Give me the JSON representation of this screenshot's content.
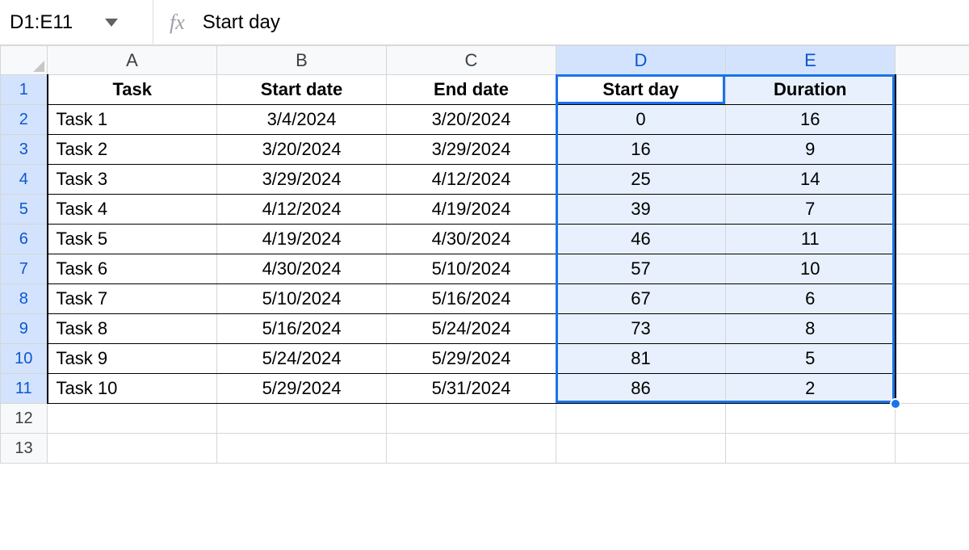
{
  "formula_bar": {
    "name_box": "D1:E11",
    "fx_value": "Start day"
  },
  "columns": [
    "A",
    "B",
    "C",
    "D",
    "E"
  ],
  "selected_columns": [
    "D",
    "E"
  ],
  "row_count_shown": 13,
  "selected_rows": [
    1,
    2,
    3,
    4,
    5,
    6,
    7,
    8,
    9,
    10,
    11
  ],
  "active_cell": "D1",
  "headers": {
    "A": "Task",
    "B": "Start date",
    "C": "End date",
    "D": "Start day",
    "E": "Duration"
  },
  "rows": [
    {
      "A": "Task 1",
      "B": "3/4/2024",
      "C": "3/20/2024",
      "D": "0",
      "E": "16"
    },
    {
      "A": "Task 2",
      "B": "3/20/2024",
      "C": "3/29/2024",
      "D": "16",
      "E": "9"
    },
    {
      "A": "Task 3",
      "B": "3/29/2024",
      "C": "4/12/2024",
      "D": "25",
      "E": "14"
    },
    {
      "A": "Task 4",
      "B": "4/12/2024",
      "C": "4/19/2024",
      "D": "39",
      "E": "7"
    },
    {
      "A": "Task 5",
      "B": "4/19/2024",
      "C": "4/30/2024",
      "D": "46",
      "E": "11"
    },
    {
      "A": "Task 6",
      "B": "4/30/2024",
      "C": "5/10/2024",
      "D": "57",
      "E": "10"
    },
    {
      "A": "Task 7",
      "B": "5/10/2024",
      "C": "5/16/2024",
      "D": "67",
      "E": "6"
    },
    {
      "A": "Task 8",
      "B": "5/16/2024",
      "C": "5/24/2024",
      "D": "73",
      "E": "8"
    },
    {
      "A": "Task 9",
      "B": "5/24/2024",
      "C": "5/29/2024",
      "D": "81",
      "E": "5"
    },
    {
      "A": "Task 10",
      "B": "5/29/2024",
      "C": "5/31/2024",
      "D": "86",
      "E": "2"
    }
  ],
  "colors": {
    "selection_fill": "#e8f0fe",
    "selection_border": "#1a73e8",
    "header_sel_bg": "#d3e3fd"
  },
  "chart_data": {
    "type": "table",
    "title": "",
    "columns": [
      "Task",
      "Start date",
      "End date",
      "Start day",
      "Duration"
    ],
    "rows": [
      [
        "Task 1",
        "3/4/2024",
        "3/20/2024",
        0,
        16
      ],
      [
        "Task 2",
        "3/20/2024",
        "3/29/2024",
        16,
        9
      ],
      [
        "Task 3",
        "3/29/2024",
        "4/12/2024",
        25,
        14
      ],
      [
        "Task 4",
        "4/12/2024",
        "4/19/2024",
        39,
        7
      ],
      [
        "Task 5",
        "4/19/2024",
        "4/30/2024",
        46,
        11
      ],
      [
        "Task 6",
        "4/30/2024",
        "5/10/2024",
        57,
        10
      ],
      [
        "Task 7",
        "5/10/2024",
        "5/16/2024",
        67,
        6
      ],
      [
        "Task 8",
        "5/16/2024",
        "5/24/2024",
        73,
        8
      ],
      [
        "Task 9",
        "5/24/2024",
        "5/29/2024",
        81,
        5
      ],
      [
        "Task 10",
        "5/29/2024",
        "5/31/2024",
        86,
        2
      ]
    ]
  }
}
